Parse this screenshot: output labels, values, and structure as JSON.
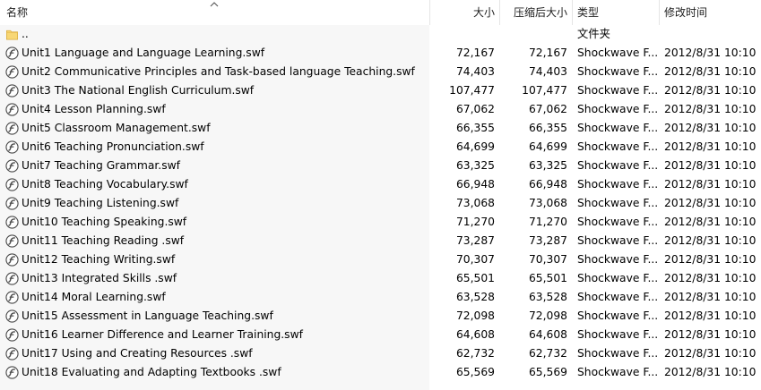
{
  "columns": {
    "name": "名称",
    "size": "大小",
    "packed": "压缩后大小",
    "type": "类型",
    "modified": "修改时间"
  },
  "parent": {
    "name": "..",
    "type": "文件夹"
  },
  "files": [
    {
      "name": "Unit1 Language and Language Learning.swf",
      "size": "72,167",
      "packed": "72,167",
      "type": "Shockwave F...",
      "modified": "2012/8/31 10:10"
    },
    {
      "name": "Unit2 Communicative Principles and Task-based language Teaching.swf",
      "size": "74,403",
      "packed": "74,403",
      "type": "Shockwave F...",
      "modified": "2012/8/31 10:10"
    },
    {
      "name": "Unit3 The National English Curriculum.swf",
      "size": "107,477",
      "packed": "107,477",
      "type": "Shockwave F...",
      "modified": "2012/8/31 10:10"
    },
    {
      "name": "Unit4 Lesson Planning.swf",
      "size": "67,062",
      "packed": "67,062",
      "type": "Shockwave F...",
      "modified": "2012/8/31 10:10"
    },
    {
      "name": "Unit5 Classroom Management.swf",
      "size": "66,355",
      "packed": "66,355",
      "type": "Shockwave F...",
      "modified": "2012/8/31 10:10"
    },
    {
      "name": "Unit6 Teaching Pronunciation.swf",
      "size": "64,699",
      "packed": "64,699",
      "type": "Shockwave F...",
      "modified": "2012/8/31 10:10"
    },
    {
      "name": "Unit7 Teaching Grammar.swf",
      "size": "63,325",
      "packed": "63,325",
      "type": "Shockwave F...",
      "modified": "2012/8/31 10:10"
    },
    {
      "name": "Unit8 Teaching Vocabulary.swf",
      "size": "66,948",
      "packed": "66,948",
      "type": "Shockwave F...",
      "modified": "2012/8/31 10:10"
    },
    {
      "name": "Unit9 Teaching Listening.swf",
      "size": "73,068",
      "packed": "73,068",
      "type": "Shockwave F...",
      "modified": "2012/8/31 10:10"
    },
    {
      "name": "Unit10 Teaching Speaking.swf",
      "size": "71,270",
      "packed": "71,270",
      "type": "Shockwave F...",
      "modified": "2012/8/31 10:10"
    },
    {
      "name": "Unit11 Teaching Reading .swf",
      "size": "73,287",
      "packed": "73,287",
      "type": "Shockwave F...",
      "modified": "2012/8/31 10:10"
    },
    {
      "name": "Unit12 Teaching Writing.swf",
      "size": "70,307",
      "packed": "70,307",
      "type": "Shockwave F...",
      "modified": "2012/8/31 10:10"
    },
    {
      "name": "Unit13 Integrated Skills .swf",
      "size": "65,501",
      "packed": "65,501",
      "type": "Shockwave F...",
      "modified": "2012/8/31 10:10"
    },
    {
      "name": "Unit14 Moral Learning.swf",
      "size": "63,528",
      "packed": "63,528",
      "type": "Shockwave F...",
      "modified": "2012/8/31 10:10"
    },
    {
      "name": "Unit15 Assessment in Language Teaching.swf",
      "size": "72,098",
      "packed": "72,098",
      "type": "Shockwave F...",
      "modified": "2012/8/31 10:10"
    },
    {
      "name": "Unit16 Learner Difference and Learner Training.swf",
      "size": "64,608",
      "packed": "64,608",
      "type": "Shockwave F...",
      "modified": "2012/8/31 10:10"
    },
    {
      "name": "Unit17 Using and Creating Resources .swf",
      "size": "62,732",
      "packed": "62,732",
      "type": "Shockwave F...",
      "modified": "2012/8/31 10:10"
    },
    {
      "name": "Unit18 Evaluating and Adapting Textbooks .swf",
      "size": "65,569",
      "packed": "65,569",
      "type": "Shockwave F...",
      "modified": "2012/8/31 10:10"
    }
  ],
  "icons": {
    "parent": "folder-icon",
    "file": "shockwave-flash-icon",
    "sort": "sort-ascending-arrow-icon"
  },
  "colors": {
    "name_column_bg": "#f7f7f7",
    "folder": "#f8d775",
    "flash_icon": "#4a4a4a"
  }
}
